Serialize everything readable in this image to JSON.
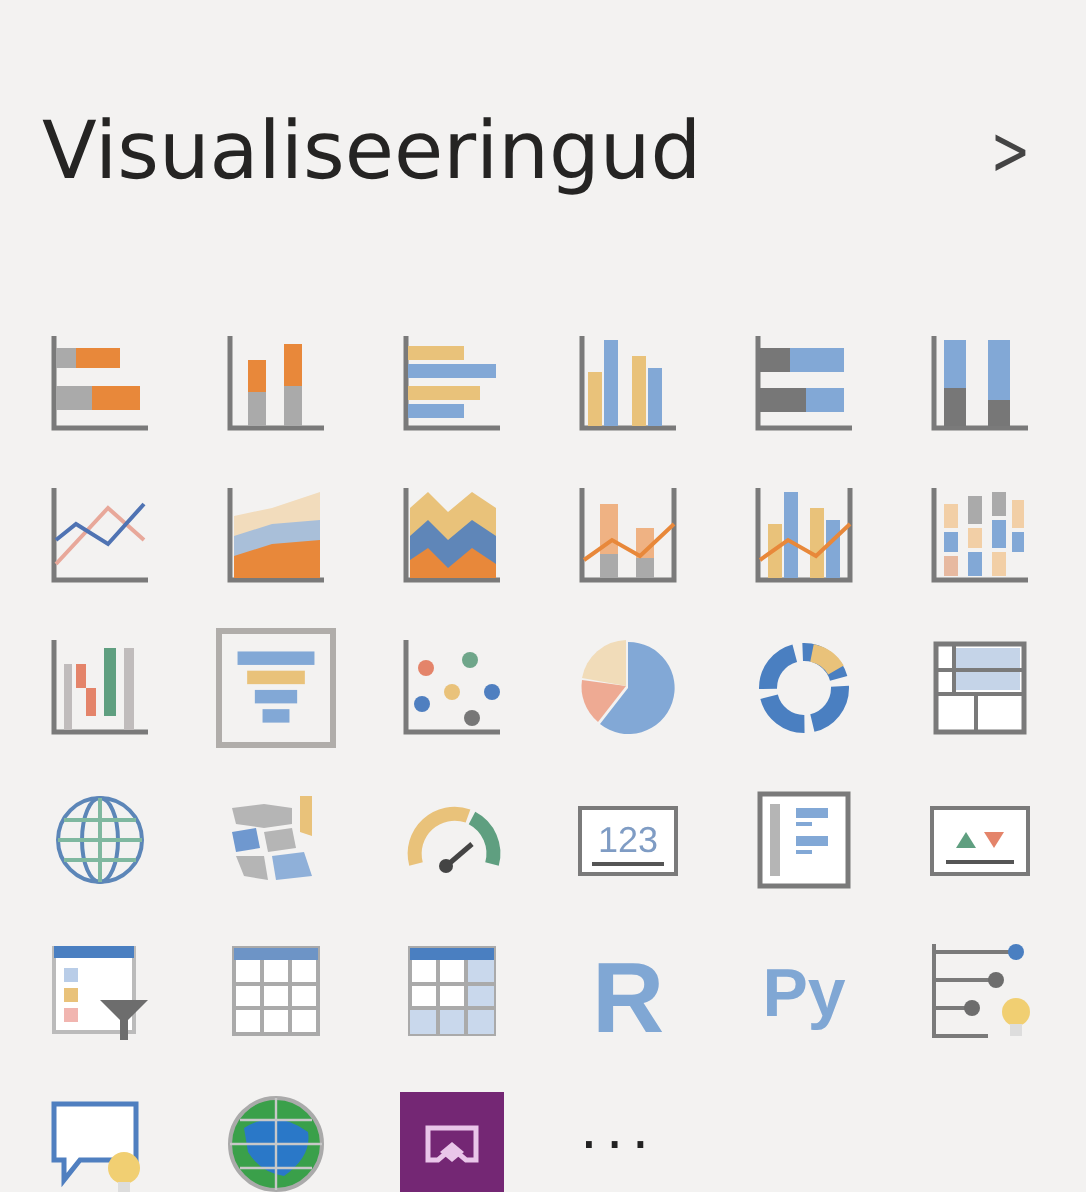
{
  "title": "Visualiseeringud",
  "chevron": ">",
  "icons": [
    {
      "kind": "stacked-bar",
      "selected": false
    },
    {
      "kind": "stacked-column",
      "selected": false
    },
    {
      "kind": "clustered-bar",
      "selected": false
    },
    {
      "kind": "clustered-column",
      "selected": false
    },
    {
      "kind": "full-bar",
      "selected": false
    },
    {
      "kind": "full-column",
      "selected": false
    },
    {
      "kind": "line",
      "selected": false
    },
    {
      "kind": "area",
      "selected": false
    },
    {
      "kind": "stacked-area",
      "selected": false
    },
    {
      "kind": "line-stacked-column",
      "selected": false
    },
    {
      "kind": "line-clustered-column",
      "selected": false
    },
    {
      "kind": "ribbon",
      "selected": false
    },
    {
      "kind": "waterfall",
      "selected": false
    },
    {
      "kind": "funnel",
      "selected": true
    },
    {
      "kind": "scatter",
      "selected": false
    },
    {
      "kind": "pie",
      "selected": false
    },
    {
      "kind": "donut",
      "selected": false
    },
    {
      "kind": "treemap",
      "selected": false
    },
    {
      "kind": "map",
      "selected": false
    },
    {
      "kind": "filled-map",
      "selected": false
    },
    {
      "kind": "gauge",
      "selected": false
    },
    {
      "kind": "card",
      "selected": false,
      "text": "123"
    },
    {
      "kind": "multirow-card",
      "selected": false
    },
    {
      "kind": "kpi",
      "selected": false
    },
    {
      "kind": "slicer",
      "selected": false
    },
    {
      "kind": "table",
      "selected": false
    },
    {
      "kind": "matrix",
      "selected": false
    },
    {
      "kind": "r",
      "selected": false,
      "text": "R"
    },
    {
      "kind": "py",
      "selected": false,
      "text": "Py"
    },
    {
      "kind": "key-influencers",
      "selected": false
    },
    {
      "kind": "qa",
      "selected": false
    },
    {
      "kind": "arcgis",
      "selected": false
    },
    {
      "kind": "powerapps",
      "selected": false
    }
  ],
  "more": "···"
}
